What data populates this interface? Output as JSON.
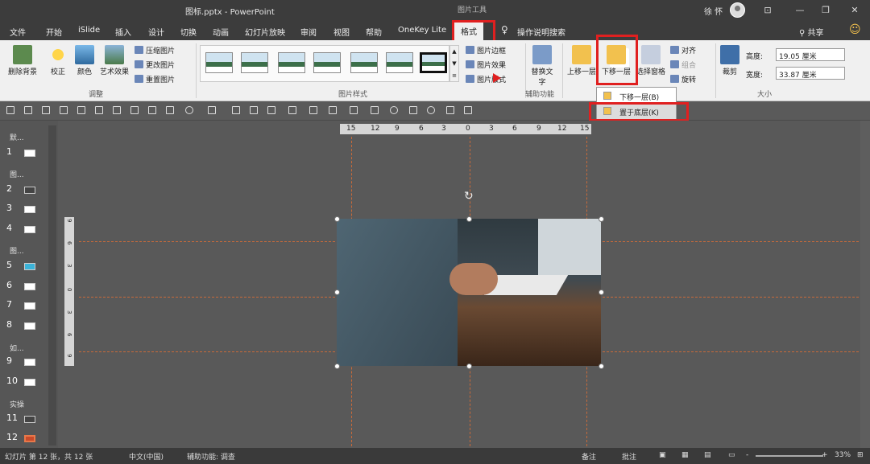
{
  "window": {
    "title": "图标.pptx - PowerPoint",
    "context_tab": "图片工具",
    "user": "徐 怀",
    "min": "—",
    "max": "❐",
    "close": "✕",
    "restore": "⊡"
  },
  "tabs": [
    "文件",
    "开始",
    "iSlide",
    "插入",
    "设计",
    "切换",
    "动画",
    "幻灯片放映",
    "审阅",
    "视图",
    "帮助",
    "OneKey Lite",
    "格式"
  ],
  "tell_me": "操作说明搜索",
  "share": "共享",
  "ribbon": {
    "adjust": {
      "remove_bg": "删除背景",
      "correct": "校正",
      "color": "颜色",
      "art": "艺术效果",
      "compress": "压缩图片",
      "change": "更改图片",
      "reset": "重置图片",
      "group": "调整"
    },
    "styles": {
      "border": "图片边框",
      "effects": "图片效果",
      "layout": "图片版式",
      "group": "图片样式"
    },
    "access": {
      "alt": "替换文字",
      "alt2": "文字",
      "group": "辅助功能"
    },
    "arrange": {
      "forward": "上移一层",
      "backward": "下移一层",
      "pane": "选择窗格",
      "align": "对齐",
      "group_btn": "组合",
      "rotate": "旋转"
    },
    "size": {
      "crop": "裁剪",
      "height_label": "高度:",
      "height": "19.05 厘米",
      "width_label": "宽度:",
      "width": "33.87 厘米",
      "group": "大小"
    }
  },
  "menu": {
    "item1": "下移一层(B)",
    "item2": "置于底层(K)"
  },
  "ruler": [
    "15",
    "12",
    "9",
    "6",
    "3",
    "0",
    "3",
    "6",
    "9",
    "12",
    "15"
  ],
  "vruler": [
    "9",
    "6",
    "3",
    "0",
    "3",
    "6",
    "9"
  ],
  "slides": {
    "sections": [
      "默...",
      "图...",
      "图...",
      "如...",
      "实操"
    ],
    "numbers": [
      "1",
      "2",
      "3",
      "4",
      "5",
      "6",
      "7",
      "8",
      "9",
      "10",
      "11",
      "12"
    ]
  },
  "status": {
    "slide": "幻灯片 第 12 张，共 12 张",
    "lang": "中文(中国)",
    "access": "辅助功能: 调查",
    "notes": "备注",
    "comments": "批注",
    "zoom": "33%",
    "minus": "-",
    "plus": "+"
  },
  "colors": {
    "accent": "#e02020",
    "dark": "#3c3c3c"
  }
}
